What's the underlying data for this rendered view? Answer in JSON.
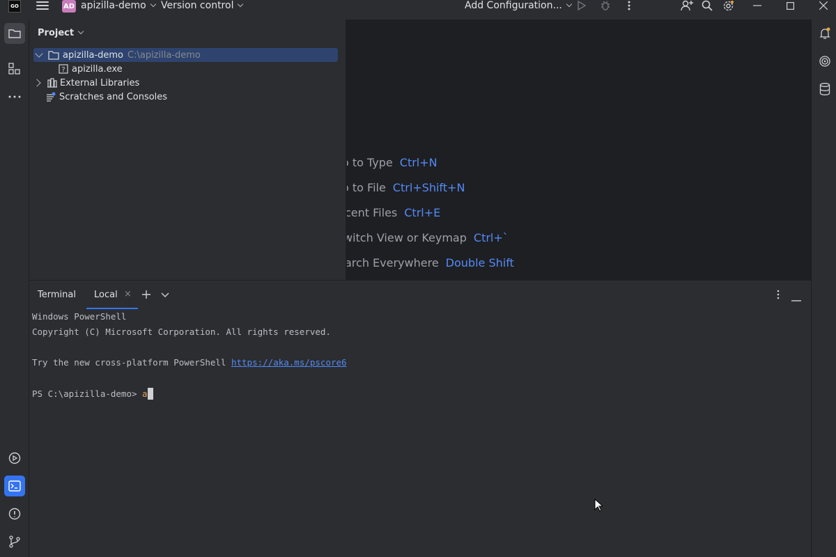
{
  "titlebar": {
    "logo_text": "GO",
    "project_badge": "AD",
    "project_name": "apizilla-demo",
    "version_control": "Version control",
    "run_config": "Add Configuration..."
  },
  "project_panel": {
    "title": "Project",
    "tree": [
      {
        "label": "apizilla-demo",
        "path": "C:\\apizilla-demo",
        "selected": true
      },
      {
        "label": "apizilla.exe"
      },
      {
        "label": "External Libraries"
      },
      {
        "label": "Scratches and Consoles"
      }
    ]
  },
  "editor_hints": [
    {
      "label": "o to Type",
      "key": "Ctrl+N"
    },
    {
      "label": "o to File",
      "key": "Ctrl+Shift+N"
    },
    {
      "label": "cent Files",
      "key": "Ctrl+E"
    },
    {
      "label": "witch View or Keymap",
      "key": "Ctrl+`"
    },
    {
      "label": "arch Everywhere",
      "key": "Double Shift"
    }
  ],
  "terminal": {
    "title": "Terminal",
    "tab_label": "Local",
    "close_glyph": "×",
    "lines": {
      "l1": "Windows PowerShell",
      "l2": "Copyright (C) Microsoft Corporation. All rights reserved.",
      "l3": "Try the new cross-platform PowerShell ",
      "link": "https://aka.ms/pscore6",
      "prompt": "PS C:\\apizilla-demo> ",
      "input": "a"
    }
  }
}
